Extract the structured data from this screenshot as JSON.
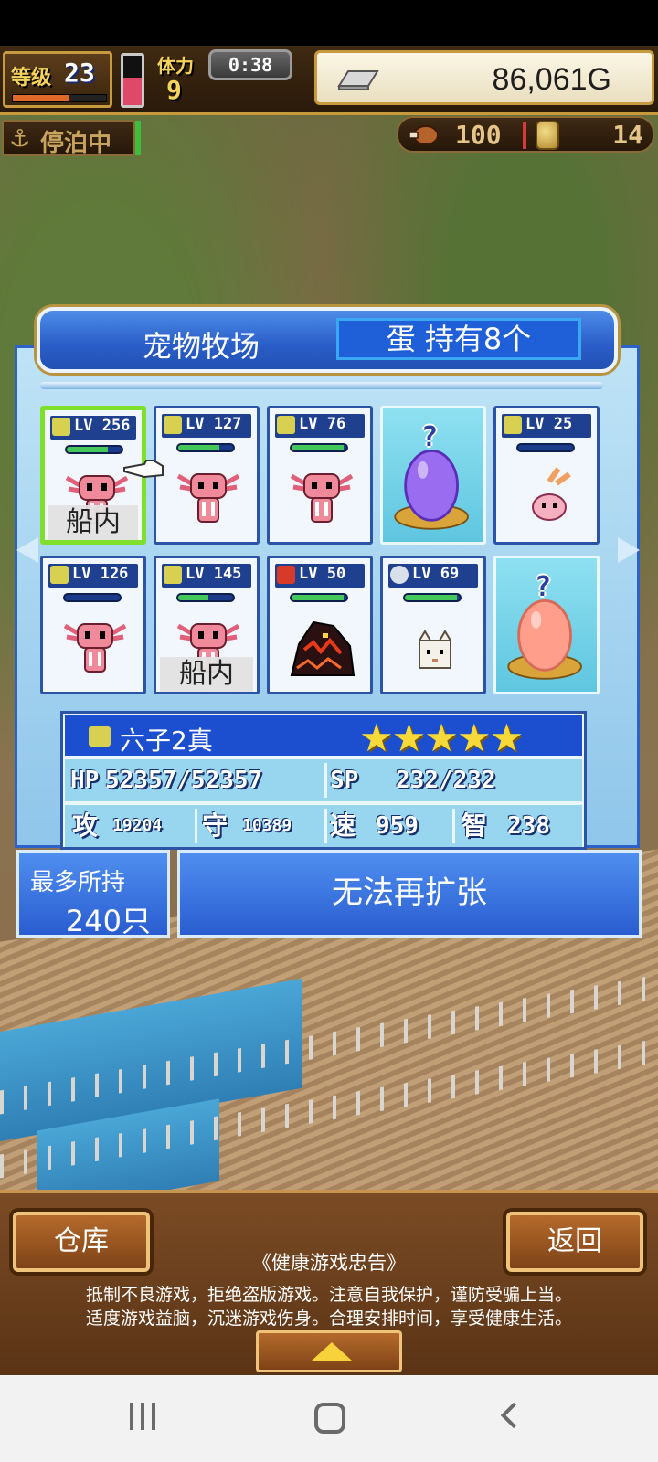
{
  "hud": {
    "level_label": "等级",
    "level": "23",
    "exp_fraction": 0.6,
    "stamina_label": "体力",
    "stamina": "9",
    "stamina_fraction": 0.55,
    "timer": "0:38",
    "gold": "86,061G",
    "status": "停泊中",
    "resource1": "100",
    "resource2": "14"
  },
  "panel": {
    "title": "宠物牧场",
    "egg_count": "蛋 持有8个"
  },
  "pets": [
    {
      "type": "pet",
      "element": "thunder",
      "level": "LV 256",
      "hp_fraction": 0.75,
      "creature": "axolotl",
      "onboard": "船内",
      "selected": true
    },
    {
      "type": "pet",
      "element": "thunder",
      "level": "LV 127",
      "hp_fraction": 0.75,
      "creature": "axolotl",
      "onboard": null,
      "selected": false
    },
    {
      "type": "pet",
      "element": "thunder",
      "level": "LV  76",
      "hp_fraction": 0.95,
      "creature": "axolotl",
      "onboard": null,
      "selected": false
    },
    {
      "type": "egg",
      "egg_label": "?",
      "egg_color": "purple"
    },
    {
      "type": "pet",
      "element": "thunder",
      "level": "LV  25",
      "hp_fraction": 0.0,
      "creature": "bunny",
      "onboard": null,
      "selected": false
    },
    {
      "type": "pet",
      "element": "thunder",
      "level": "LV 126",
      "hp_fraction": 0.0,
      "creature": "axolotl",
      "onboard": null,
      "selected": false
    },
    {
      "type": "pet",
      "element": "thunder",
      "level": "LV 145",
      "hp_fraction": 0.55,
      "creature": "axolotl",
      "onboard": "船内",
      "selected": false
    },
    {
      "type": "pet",
      "element": "fire",
      "level": "LV  50",
      "hp_fraction": 0.95,
      "creature": "lava-beast",
      "onboard": null,
      "selected": false
    },
    {
      "type": "pet",
      "element": "wind",
      "level": "LV  69",
      "hp_fraction": 0.95,
      "creature": "cube-cat",
      "onboard": null,
      "selected": false
    },
    {
      "type": "egg",
      "egg_label": "?",
      "egg_color": "peach"
    }
  ],
  "selected_pet": {
    "name": "六子2真",
    "stars": "★★★★★",
    "hp_label": "HP",
    "hp": "52357/52357",
    "sp_label": "SP",
    "sp": "232/232",
    "atk_label": "攻",
    "atk": "19204",
    "def_label": "守",
    "def": "10389",
    "spd_label": "速",
    "spd": "959",
    "int_label": "智",
    "int": "238"
  },
  "capacity": {
    "label": "最多所持",
    "value": "240只"
  },
  "expand_button": "无法再扩张",
  "bottom": {
    "left_button": "仓库",
    "right_button": "返回",
    "notice_title": "《健康游戏忠告》",
    "notice_line1": "抵制不良游戏，拒绝盗版游戏。注意自我保护，谨防受骗上当。",
    "notice_line2": "适度游戏益脑，沉迷游戏伤身。合理安排时间，享受健康生活。"
  },
  "icons": {
    "gold": "gold-bar-icon",
    "anchor": "anchor-icon",
    "meat": "meat-icon",
    "coin": "medal-icon"
  },
  "colors": {
    "accent_blue": "#2a5dd0",
    "hud_brown": "#3f2a12",
    "selected_border": "#7ee02a"
  }
}
